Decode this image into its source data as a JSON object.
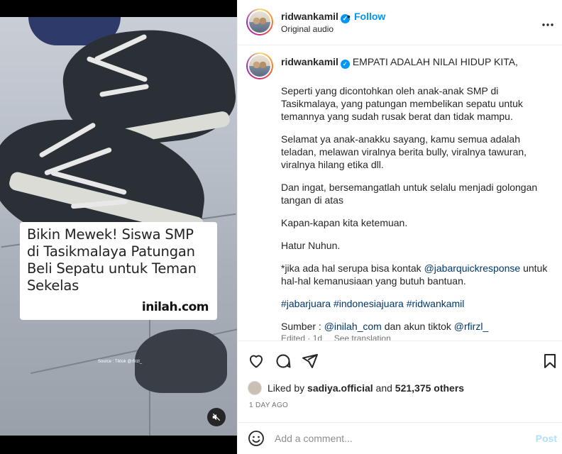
{
  "media": {
    "caption_text": "Bikin Mewek! Siswa SMP di Tasikmalaya Patungan Beli Sepatu untuk Teman Sekelas",
    "brand": "inilah.com",
    "source": "Source : Tiktok @rfirzl_",
    "mute_icon": "speaker-muted-icon"
  },
  "header": {
    "username": "ridwankamil",
    "separator": "•",
    "follow_label": "Follow",
    "audio_label": "Original audio",
    "more_icon": "more-horizontal-icon"
  },
  "caption": {
    "username": "ridwankamil",
    "headline": "EMPATI ADALAH NILAI HIDUP KITA,",
    "p1": "Seperti yang dicontohkan oleh anak-anak SMP di Tasikmalaya, yang patungan membelikan sepatu untuk temannya yang sudah rusak berat dan tidak mampu.",
    "p2": "Selamat ya anak-anakku sayang, kamu semua adalah teladan, melawan viralnya berita bully, viralnya tawuran, viralnya hilang etika dll.",
    "p3": "Dan ingat, bersemangatlah untuk selalu menjadi golongan tangan di atas",
    "p4": "Kapan-kapan kita ketemuan.",
    "p5": "Hatur Nuhun.",
    "p6_pre": "*jika ada hal serupa bisa kontak ",
    "p6_mention": "@jabarquickresponse",
    "p6_post": " untuk hal-hal kemanusiaan yang butuh bantuan.",
    "tag1": "#jabarjuara",
    "tag2": "#indonesiajuara",
    "tag3": "#ridwankamil",
    "src_pre": "Sumber : ",
    "src_mention1": "@inilah_com",
    "src_mid": " dan akun tiktok ",
    "src_mention2": "@rfirzl_",
    "meta": "Edited · 1d     See translation"
  },
  "actions": {
    "like_icon": "heart-icon",
    "comment_icon": "comment-icon",
    "share_icon": "send-icon",
    "save_icon": "bookmark-icon"
  },
  "likes": {
    "prefix": "Liked by ",
    "user": "sadiya.official",
    "mid": " and ",
    "count": "521,375 others"
  },
  "date": "1 DAY AGO",
  "comment": {
    "placeholder": "Add a comment...",
    "post_label": "Post",
    "emoji_icon": "emoji-icon"
  },
  "colors": {
    "accent": "#0095f6",
    "link": "#00376b"
  }
}
